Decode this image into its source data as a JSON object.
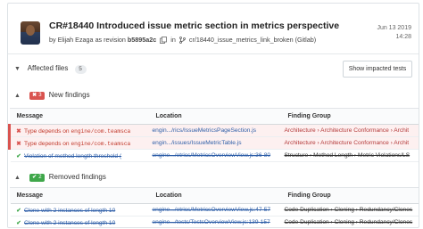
{
  "header": {
    "title": "CR#18440 Introduced issue metric section in metrics perspective",
    "by_prefix": "by",
    "author": "Elijah Ezaga",
    "revision_prefix": "as revision",
    "revision": "b5895a2c",
    "in_label": "in",
    "branch": "cr/18440_issue_metrics_link_broken (Gitlab)",
    "date": "Jun 13 2019",
    "time": "14:28"
  },
  "affected": {
    "label": "Affected files",
    "count": "5",
    "button": "Show impacted tests"
  },
  "new_findings": {
    "count": "3",
    "title": "New findings",
    "columns": [
      "Message",
      "Location",
      "Finding Group"
    ],
    "rows": [
      {
        "message_a": "Type depends on ",
        "message_code": "engine/com.teamsca",
        "location": "engin.../rics/IssueMetricsPageSection.js",
        "group": "Architecture › Architecture Conformance › Archit"
      },
      {
        "message_a": "Type depends on ",
        "message_code": "engine/com.teamsca",
        "location": "engin.../issues/IssueMetricTable.js",
        "group": "Architecture › Architecture Conformance › Archit"
      },
      {
        "message_a": "Violation of method length threshold (",
        "message_code": "",
        "location": "engine.../etrics/MetricsOverviewView.js:36-80",
        "group": "Structure › Method Length › Metric Violations/LS"
      }
    ]
  },
  "removed_findings": {
    "count": "2",
    "title": "Removed findings",
    "columns": [
      "Message",
      "Location",
      "Finding Group"
    ],
    "rows": [
      {
        "message": "Clone with 2 instances of length 10",
        "location": "engine.../etrics/MetricsOverviewView.js:47-57",
        "group": "Code Duplication › Cloning › Redundancy/Clones"
      },
      {
        "message": "Clone with 2 instances of length 10",
        "location": "engine.../tests/TestsOverviewView.js:139-157",
        "group": "Code Duplication › Cloning › Redundancy/Clones"
      }
    ]
  },
  "colors": {
    "new": "#d9534f",
    "removed": "#3fa74a",
    "link": "#2f5fa8"
  }
}
